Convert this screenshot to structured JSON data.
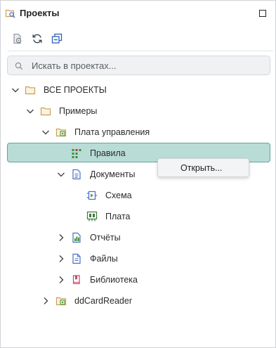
{
  "header": {
    "title": "Проекты",
    "icon": "projects-icon",
    "maximize_icon": "maximize-icon"
  },
  "toolbar": {
    "icons": [
      "properties-icon",
      "refresh-icon",
      "collapse-all-icon"
    ]
  },
  "search": {
    "placeholder": "Искать в проектах...",
    "value": "",
    "icon": "search-icon"
  },
  "tree": {
    "all_projects": "ВСЕ ПРОЕКТЫ",
    "examples": "Примеры",
    "board_project": "Плата управления",
    "rules": "Правила",
    "documents": "Документы",
    "schema": "Схема",
    "board": "Плата",
    "reports": "Отчёты",
    "files": "Файлы",
    "library": "Библиотека",
    "card_reader": "ddCardReader"
  },
  "context_menu": {
    "open": "Открыть..."
  },
  "colors": {
    "selection_bg": "#b9dcd7",
    "selection_border": "#5fa59b",
    "folder": "#c9a15a",
    "project": "#5a9a3c",
    "document": "#4a6fc9",
    "library": "#c24a6a"
  }
}
